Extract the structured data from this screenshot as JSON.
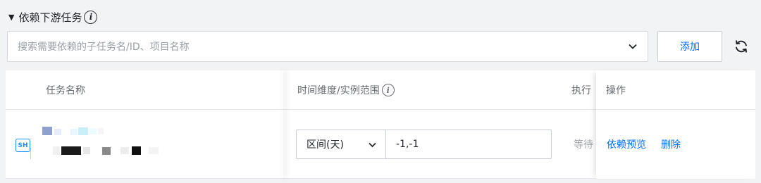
{
  "section": {
    "title": "依赖下游任务",
    "caret": "▼",
    "info": "i"
  },
  "search": {
    "placeholder": "搜索需要依赖的子任务名/ID、项目名称"
  },
  "toolbar": {
    "add_label": "添加"
  },
  "table": {
    "headers": {
      "name": "任务名称",
      "range": "时间维度/实例范围",
      "range_info": "i",
      "exec": "执行",
      "op": "操作"
    },
    "rows": [
      {
        "badge": "SH",
        "range_unit": "区间(天)",
        "range_value": "-1,-1",
        "exec_status": "等待",
        "actions": {
          "preview": "依赖预览",
          "delete": "删除"
        }
      }
    ]
  },
  "colors": {
    "accent": "#006eff",
    "badge": "#1890ff",
    "muted_text": "#9aa0a6"
  }
}
